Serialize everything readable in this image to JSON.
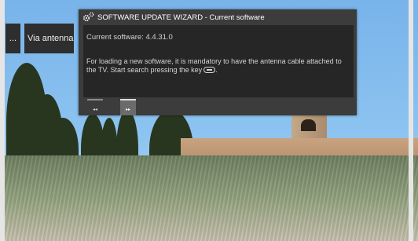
{
  "breadcrumb": {
    "dots_label": "...",
    "antenna_label": "Via antenna"
  },
  "dialog": {
    "title": "SOFTWARE UPDATE WIZARD - Current software",
    "current_software": "Current software: 4.4.31.0",
    "message": "For loading a new software, it is mandatory to have the antenna cable attached to the TV. Start search pressing the key",
    "message_end": ".",
    "icons": [
      "gears-icon",
      "ok-key-icon",
      "rewind-icon",
      "fast-forward-icon"
    ]
  },
  "nav": {
    "prev_glyph": "◂◂",
    "next_glyph": "▸▸"
  },
  "colors": {
    "dialog_bg": "#3c3c3c",
    "content_bg": "#262626",
    "crumb_bg": "#2e2e2e",
    "highlight": "#6b6b6b"
  }
}
